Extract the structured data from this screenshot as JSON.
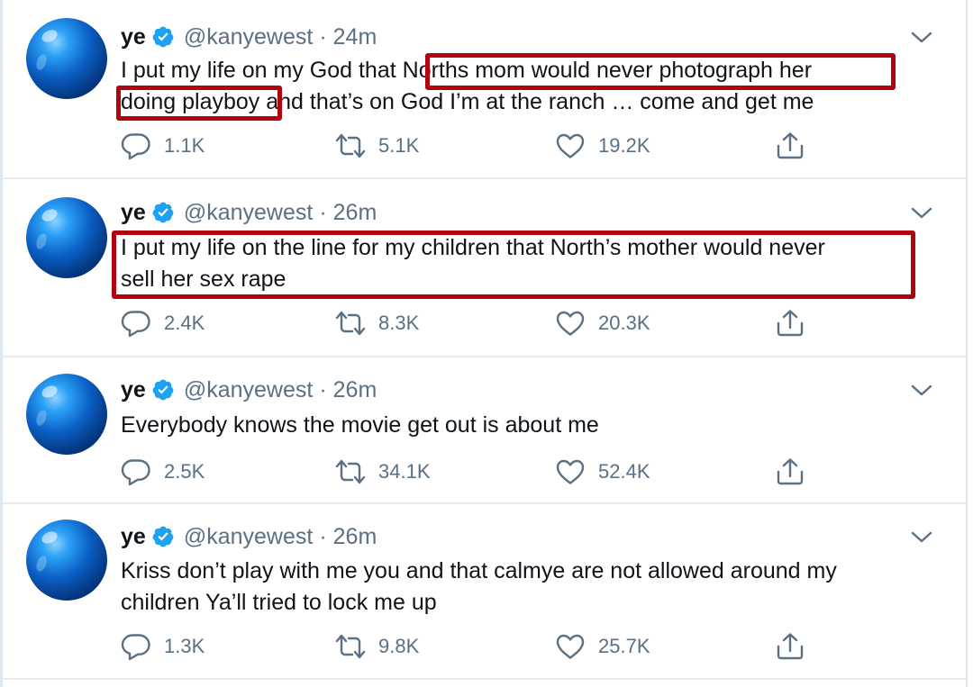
{
  "tweets": [
    {
      "name": "ye",
      "handle": "@kanyewest",
      "separator": "·",
      "time": "24m",
      "lines": [
        "I put my life on my God that Norths mom would never photograph her",
        "doing playboy and that’s on God   I’m at the ranch … come and get me"
      ],
      "reply_count": "1.1K",
      "retweet_count": "5.1K",
      "like_count": "19.2K"
    },
    {
      "name": "ye",
      "handle": "@kanyewest",
      "separator": "·",
      "time": "26m",
      "lines": [
        "I put my life on the line for my children that North’s mother would never",
        "sell her sex rape"
      ],
      "reply_count": "2.4K",
      "retweet_count": "8.3K",
      "like_count": "20.3K"
    },
    {
      "name": "ye",
      "handle": "@kanyewest",
      "separator": "·",
      "time": "26m",
      "lines": [
        "Everybody knows the movie get out is about me"
      ],
      "reply_count": "2.5K",
      "retweet_count": "34.1K",
      "like_count": "52.4K"
    },
    {
      "name": "ye",
      "handle": "@kanyewest",
      "separator": "·",
      "time": "26m",
      "lines": [
        "Kriss don’t play with me  you and that calmye are not allowed around my",
        "children   Ya’ll tried to lock me up"
      ],
      "reply_count": "1.3K",
      "retweet_count": "9.8K",
      "like_count": "25.7K"
    }
  ],
  "icons": {
    "verified": "verified-badge-icon",
    "caret": "chevron-down-icon",
    "reply": "reply-icon",
    "retweet": "retweet-icon",
    "like": "heart-icon",
    "share": "share-icon"
  },
  "colors": {
    "verified_blue": "#1da1f2",
    "secondary_text": "#5b7083",
    "highlight_box": "#b0050e"
  }
}
